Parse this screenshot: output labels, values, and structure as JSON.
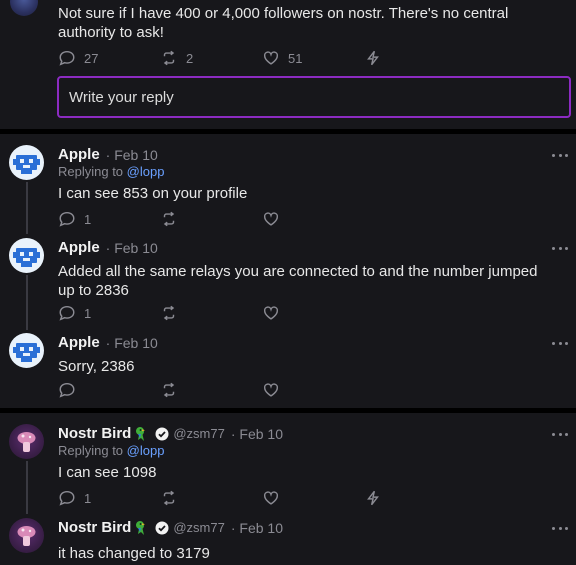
{
  "main_note": {
    "text": "Not sure if I have 400 or 4,000 followers on nostr. There's no central authority to ask!",
    "reply_count": "27",
    "repost_count": "2",
    "like_count": "51"
  },
  "reply_box": {
    "placeholder": "Write your reply"
  },
  "posts": [
    {
      "name": "Apple",
      "date": "· Feb 10",
      "replying_prefix": "Replying to",
      "replying_to": "@lopp",
      "text": "I can see 853 on your profile",
      "reply_count": "1"
    },
    {
      "name": "Apple",
      "date": "· Feb 10",
      "text": "Added all the same relays you are connected to and the number jumped up to 2836",
      "reply_count": "1"
    },
    {
      "name": "Apple",
      "date": "· Feb 10",
      "text": "Sorry, 2386"
    },
    {
      "name": "Nostr Bird",
      "handle": "@zsm77",
      "date": "· Feb 10",
      "replying_prefix": "Replying to",
      "replying_to": "@lopp",
      "text": "I can  see 1098",
      "reply_count": "1"
    },
    {
      "name": "Nostr Bird",
      "handle": "@zsm77",
      "date": "· Feb 10",
      "text": "it has changed to 3179"
    }
  ],
  "colors": {
    "accent": "#8c2bc2",
    "link": "#6aa0ff",
    "muted": "#8b8b93",
    "background": "#17171b"
  }
}
